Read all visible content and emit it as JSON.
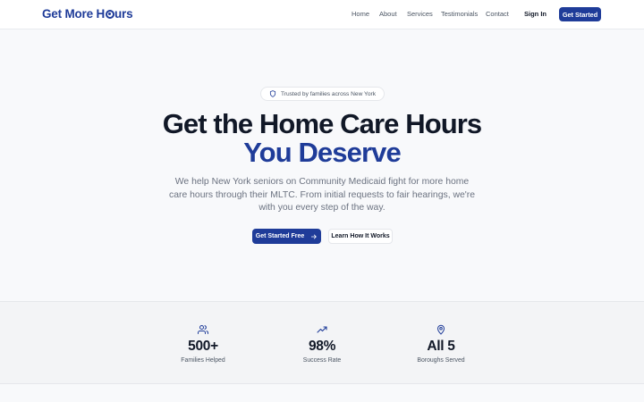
{
  "brand": {
    "logo_part1": "Get More H",
    "logo_part2": "urs",
    "accent_color": "#1f3c99"
  },
  "nav": {
    "items": [
      {
        "label": "Home"
      },
      {
        "label": "About"
      },
      {
        "label": "Services"
      },
      {
        "label": "Testimonials"
      },
      {
        "label": "Contact"
      }
    ],
    "sign_in": "Sign In",
    "get_started": "Get Started"
  },
  "hero": {
    "badge_icon": "shield-icon",
    "badge_text": "Trusted by families across New York",
    "title_line1": "Get the Home Care Hours",
    "title_line2": "You Deserve",
    "subtitle": "We help New York seniors on Community Medicaid fight for more home care hours through their MLTC. From initial requests to fair hearings, we're with you every step of the way.",
    "primary_cta": "Get Started Free",
    "primary_cta_icon": "arrow-right-icon",
    "secondary_cta": "Learn How It Works"
  },
  "stats": [
    {
      "icon": "users-icon",
      "value": "500+",
      "label": "Families Helped"
    },
    {
      "icon": "trending-up-icon",
      "value": "98%",
      "label": "Success Rate"
    },
    {
      "icon": "map-pin-icon",
      "value": "All 5",
      "label": "Boroughs Served"
    }
  ]
}
